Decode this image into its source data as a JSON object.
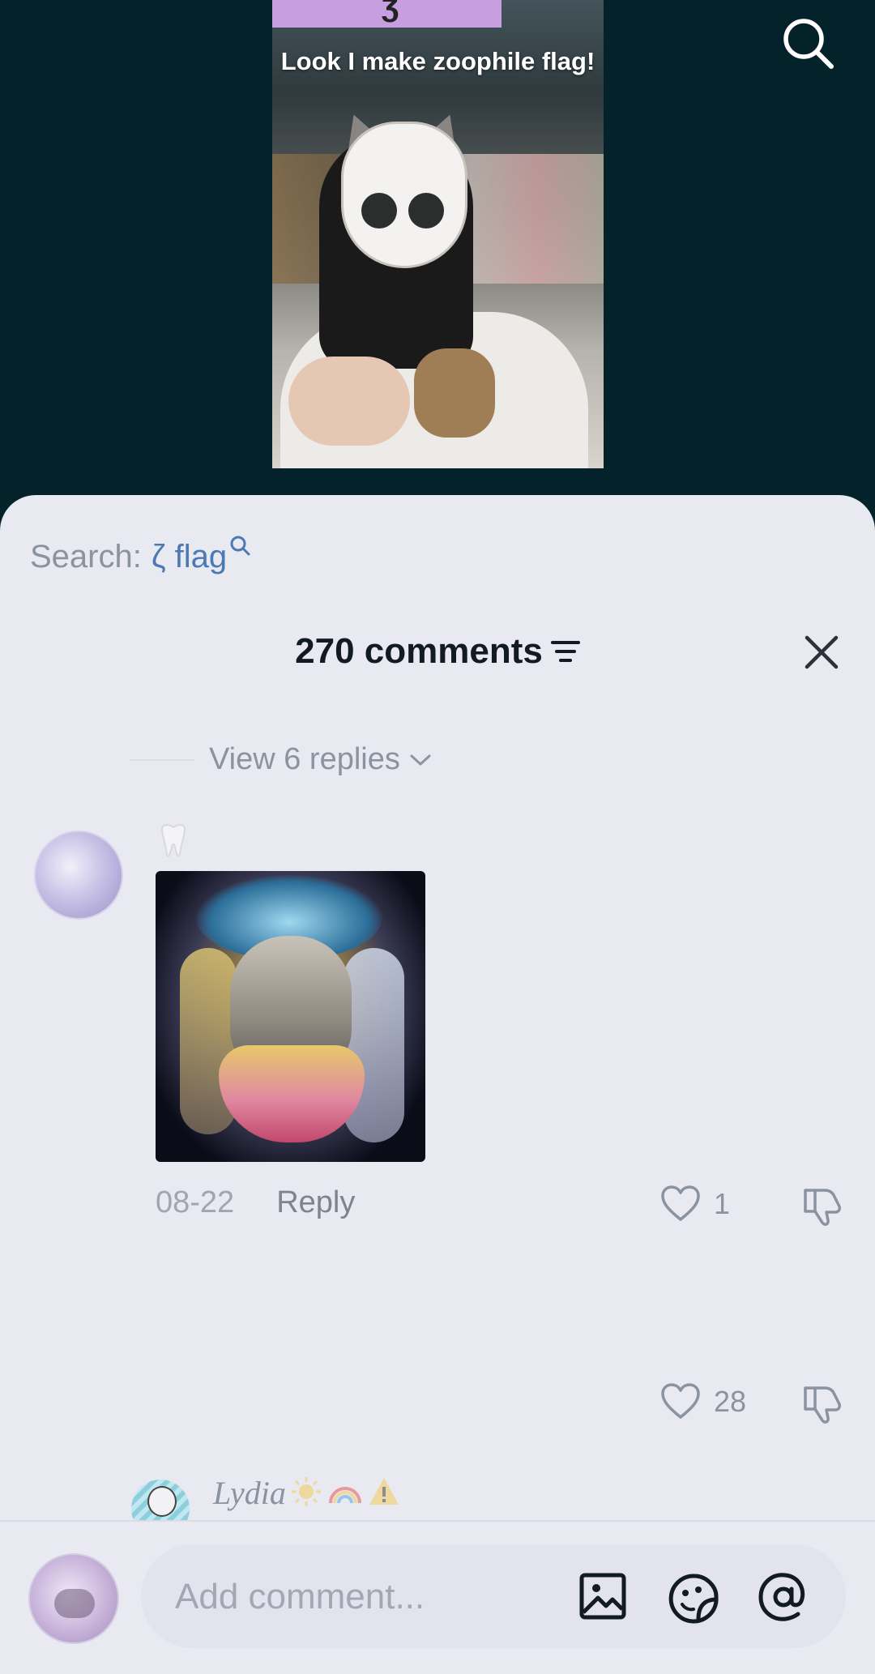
{
  "video": {
    "caption": "Look I make zoophile flag!",
    "banner_glyph": "ʒ"
  },
  "header": {
    "search_icon": "search-icon"
  },
  "sheet": {
    "search_prefix": "Search:",
    "search_term": "ζ flag",
    "comments_count_label": "270 comments",
    "view_replies_label": "View 6 replies"
  },
  "comments": [
    {
      "date": "08-22",
      "reply_label": "Reply",
      "likes": "1"
    },
    {
      "likes": "28"
    }
  ],
  "next_comment": {
    "username": "Lydia"
  },
  "composer": {
    "placeholder": "Add comment..."
  },
  "colors": {
    "background_video": "#03222a",
    "sheet": "#e9e9f2",
    "accent_link": "#4a79b3",
    "muted_text": "#8b93a0",
    "title_text": "#121a22"
  }
}
